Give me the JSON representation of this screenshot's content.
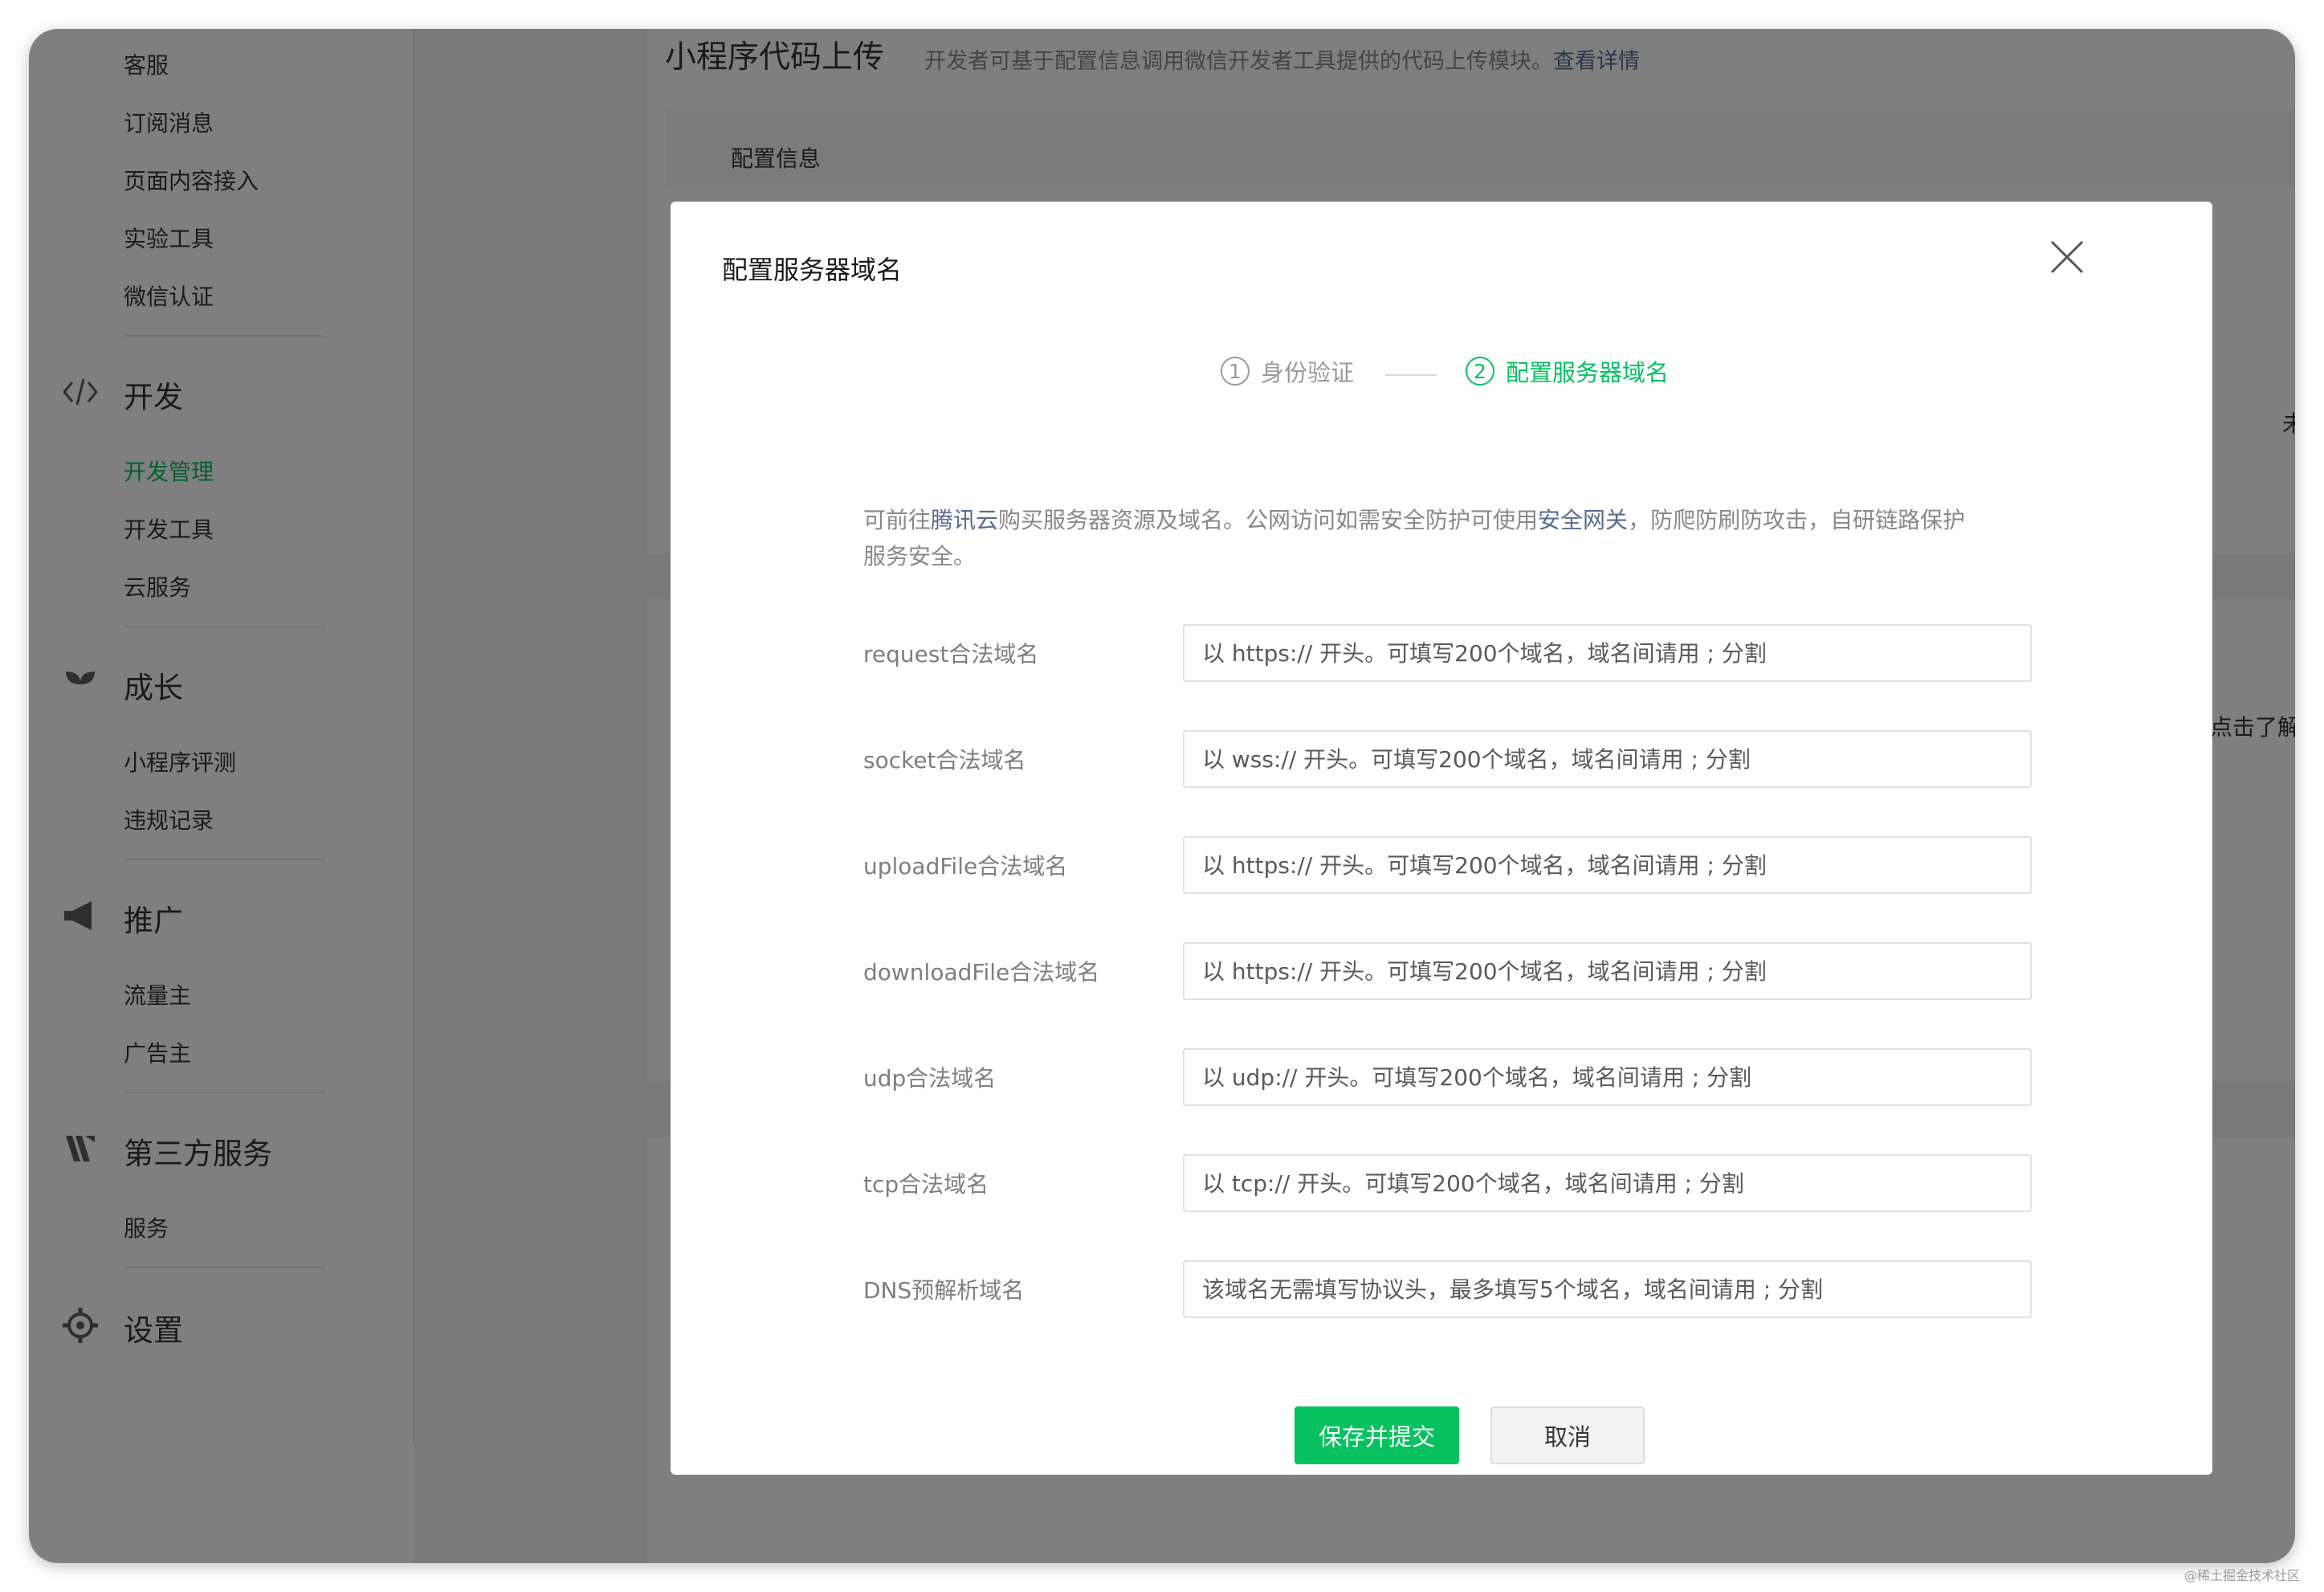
{
  "sidebar": {
    "items_top": [
      "客服",
      "订阅消息",
      "页面内容接入",
      "实验工具",
      "微信认证"
    ],
    "sections": [
      {
        "title": "开发",
        "icon": "code-icon",
        "items": [
          "开发管理",
          "开发工具",
          "云服务"
        ],
        "active": "开发管理"
      },
      {
        "title": "成长",
        "icon": "sprout-icon",
        "items": [
          "小程序评测",
          "违规记录"
        ]
      },
      {
        "title": "推广",
        "icon": "megaphone-icon",
        "items": [
          "流量主",
          "广告主"
        ]
      },
      {
        "title": "第三方服务",
        "icon": "third-party-icon",
        "items": [
          "服务"
        ]
      },
      {
        "title": "设置",
        "icon": "gear-icon",
        "items": []
      }
    ]
  },
  "main": {
    "page_title": "小程序代码上传",
    "page_desc": "开发者可基于配置信息调用微信开发者工具提供的代码上传模块。",
    "page_desc_link": "查看详情",
    "config_label": "配置信息",
    "edge_text_1": "未",
    "edge_text_2": "点击了解"
  },
  "modal": {
    "title": "配置服务器域名",
    "steps": [
      {
        "num": "1",
        "label": "身份验证"
      },
      {
        "num": "2",
        "label": "配置服务器域名"
      }
    ],
    "notice": {
      "part1": "可前往",
      "link1": "腾讯云",
      "part2": "购买服务器资源及域名。公网访问如需安全防护可使用",
      "link2": "安全网关",
      "part3": "，防爬防刷防攻击，自研链路保护服务安全。"
    },
    "fields": [
      {
        "label": "request合法域名",
        "placeholder": "以 https:// 开头。可填写200个域名，域名间请用 ; 分割"
      },
      {
        "label": "socket合法域名",
        "placeholder": "以 wss:// 开头。可填写200个域名，域名间请用 ; 分割"
      },
      {
        "label": "uploadFile合法域名",
        "placeholder": "以 https:// 开头。可填写200个域名，域名间请用 ; 分割"
      },
      {
        "label": "downloadFile合法域名",
        "placeholder": "以 https:// 开头。可填写200个域名，域名间请用 ; 分割"
      },
      {
        "label": "udp合法域名",
        "placeholder": "以 udp:// 开头。可填写200个域名，域名间请用 ; 分割"
      },
      {
        "label": "tcp合法域名",
        "placeholder": "以 tcp:// 开头。可填写200个域名，域名间请用 ; 分割"
      },
      {
        "label": "DNS预解析域名",
        "placeholder": "该域名无需填写协议头，最多填写5个域名，域名间请用 ; 分割"
      }
    ],
    "save_label": "保存并提交",
    "cancel_label": "取消"
  },
  "watermark": "@稀土掘金技术社区",
  "colors": {
    "accent": "#07c160",
    "link": "#576b95",
    "overlay": "rgba(0,0,0,0.5)"
  }
}
